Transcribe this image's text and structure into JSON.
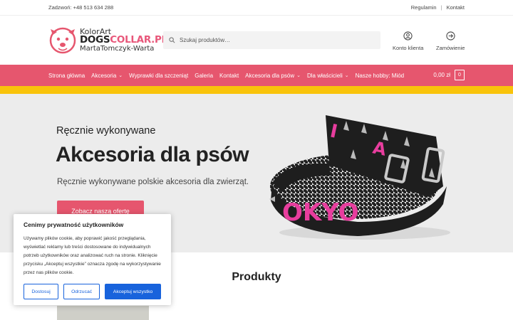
{
  "topbar": {
    "phone": "Zadzwoń: +48 513 634 288",
    "links": [
      "Regulamin",
      "Kontakt"
    ]
  },
  "logo": {
    "line1": "KolorArt",
    "line2a": "DOGS",
    "line2b": "COLLAR.PL",
    "line3": "MartaTomczyk-Warta"
  },
  "search": {
    "placeholder": "Szukaj produktów…"
  },
  "header": {
    "account_label": "Konto klienta",
    "orders_label": "Zamówienie"
  },
  "nav": {
    "items": [
      {
        "label": "Strona główna",
        "dropdown": false
      },
      {
        "label": "Akcesoria",
        "dropdown": true
      },
      {
        "label": "Wyprawki dla szczeniąt",
        "dropdown": false
      },
      {
        "label": "Galeria",
        "dropdown": false
      },
      {
        "label": "Kontakt",
        "dropdown": false
      },
      {
        "label": "Akcesoria dla psów",
        "dropdown": true
      },
      {
        "label": "Dla właścicieli",
        "dropdown": true
      },
      {
        "label": "Nasze hobby: Miód",
        "dropdown": false
      }
    ],
    "cart_total": "0,00 zł",
    "cart_count": "0"
  },
  "hero": {
    "subtitle": "Ręcznie wykonywane",
    "title": "Akcesoria dla psów",
    "description": "Ręcznie wykonywane polskie akcesoria dla zwierząt.",
    "cta": "Zobacz naszą ofertę",
    "collar_letters": "OKYO"
  },
  "products": {
    "title": "Produkty"
  },
  "cookie": {
    "title": "Cenimy prywatność użytkowników",
    "text": "Używamy plików cookie, aby poprawić jakość przeglądania, wyświetlać reklamy lub treści dostosowane do indywidualnych potrzeb użytkowników oraz analizować ruch na stronie. Kliknięcie przycisku „Akceptuj wszystkie” oznacza zgodę na wykorzystywanie przez nas plików cookie.",
    "customize": "Dostosuj",
    "reject": "Odrzucać",
    "accept": "Akceptuj wszystko"
  },
  "colors": {
    "brand_pink": "#e6566e",
    "accent_yellow": "#f9c30a",
    "cookie_blue": "#1863dc"
  }
}
